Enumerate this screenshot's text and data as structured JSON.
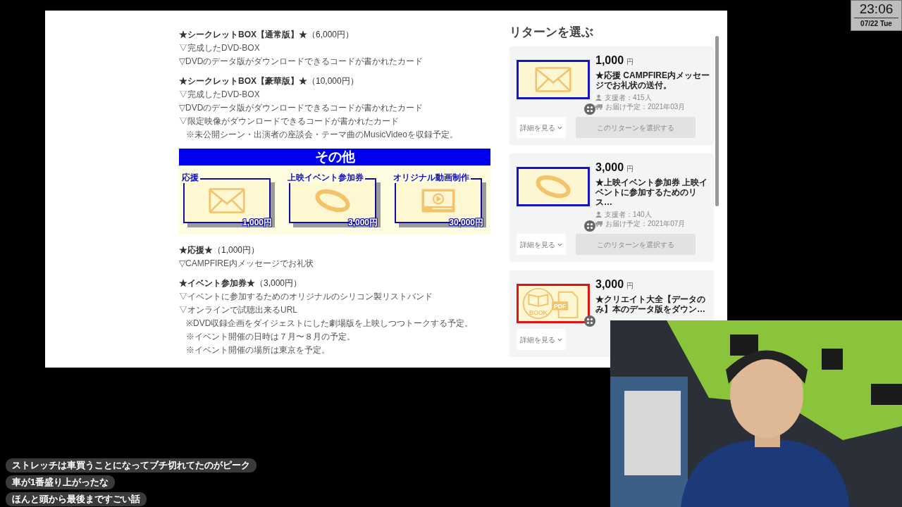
{
  "clock": {
    "time": "23:06",
    "date": "07/22 Tue"
  },
  "description_top": [
    {
      "kind": "heading",
      "title": "★シークレットBOX【通常版】★",
      "price": "（6,000円）"
    },
    {
      "kind": "item",
      "text": "▽完成したDVD-BOX"
    },
    {
      "kind": "item",
      "text": "▽DVDのデータ版がダウンロードできるコードが書かれたカード"
    },
    {
      "kind": "heading",
      "title": "★シークレットBOX【豪華版】★",
      "price": "（10,000円）"
    },
    {
      "kind": "item",
      "text": "▽完成したDVD-BOX"
    },
    {
      "kind": "item",
      "text": "▽DVDのデータ版がダウンロードできるコードが書かれたカード"
    },
    {
      "kind": "item",
      "text": "▽限定映像がダウンロードできるコードが書かれたカード"
    },
    {
      "kind": "note",
      "text": "※未公開シーン・出演者の座談会・テーマ曲のMusicVideoを収録予定。"
    }
  ],
  "section_banner": "その他",
  "tiles": [
    {
      "label": "応援",
      "kind": "envelope",
      "price": "1,000円"
    },
    {
      "label": "上映イベント参加券",
      "kind": "band",
      "price": "3,000円"
    },
    {
      "label": "オリジナル動画制作",
      "kind": "video",
      "price": "30,000円"
    }
  ],
  "description_bottom": [
    {
      "kind": "heading",
      "title": "★応援★",
      "price": "（1,000円）"
    },
    {
      "kind": "item",
      "text": "▽CAMPFIRE内メッセージでお礼状"
    },
    {
      "kind": "heading",
      "title": "★イベント参加券★",
      "price": "（3,000円）"
    },
    {
      "kind": "item",
      "text": "▽イベントに参加するためのオリジナルのシリコン製リストバンド"
    },
    {
      "kind": "item",
      "text": "▽オンラインで試聴出来るURL"
    },
    {
      "kind": "note",
      "text": "※DVD収録企画をダイジェストにした劇場版を上映しつつトークする予定。"
    },
    {
      "kind": "note",
      "text": "※イベント開催の日時は７月〜８月の予定。"
    },
    {
      "kind": "note",
      "text": "※イベント開催の場所は東京を予定。"
    }
  ],
  "returns_title": "リターンを選ぶ",
  "returns": [
    {
      "price": "1,000",
      "unit": "円",
      "title": "★応援 CAMPFIRE内メッセージでお礼状の送付。",
      "supporters": "支援者：415人",
      "delivery": "お届け予定：2021年03月",
      "color": "#1414c8",
      "kind": "envelope",
      "detail_button": "詳細を見る",
      "select_button": {
        "label": "このリターンを選択する",
        "disabled": true
      }
    },
    {
      "price": "3,000",
      "unit": "円",
      "title": "★上映イベント参加券 上映イベントに参加するためのリス…",
      "supporters": "支援者：140人",
      "delivery": "お届け予定：2021年07月",
      "color": "#1414c8",
      "kind": "band",
      "detail_button": "詳細を見る",
      "select_button": {
        "label": "このリターンを選択する",
        "disabled": true
      }
    },
    {
      "price": "3,000",
      "unit": "円",
      "title": "★クリエイト大全【データのみ】本のデータ版をダウン…",
      "color": "#e01414",
      "kind": "book_pdf",
      "icon_labels": [
        "BOOK",
        "PDF"
      ],
      "detail_button": "詳細を見る"
    }
  ],
  "chat": [
    {
      "text": "ストレッチは車買うことになってブチ切れてたのがピーク"
    },
    {
      "text": "車が1番盛り上がったな"
    },
    {
      "text": "ほんと頭から最後まですごい話"
    }
  ]
}
